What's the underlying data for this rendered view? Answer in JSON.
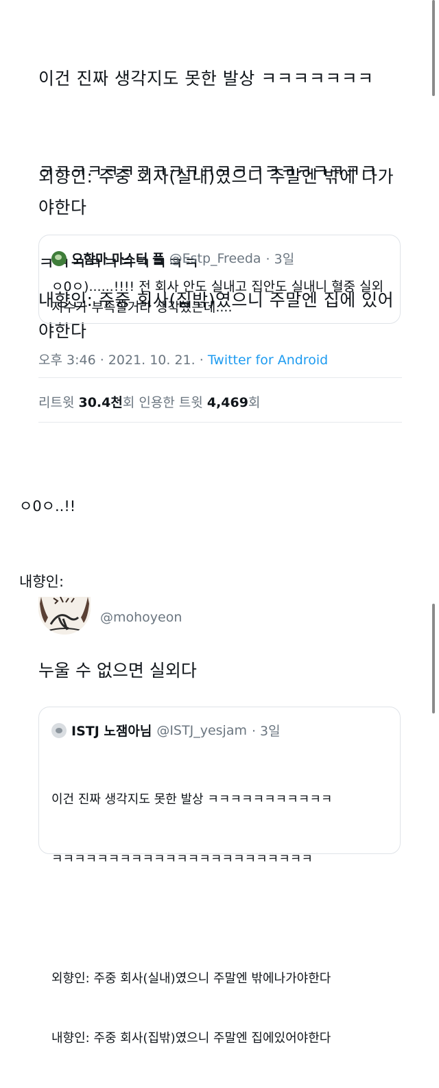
{
  "tweet1": {
    "text_line_1": "이건 진짜 생각지도 못한 발상 ㅋㅋㅋㅋㅋㅋㅋ",
    "text_line_2": "ㅋㅋㅋㅋㅋㅋㅋㅋㅋㅋㅋㅋㅋㅋㅋㅋㅋㅋㅋㅋㅋ",
    "text_line_3": "ㅋㅋㅋㅋㅋㅋㅋㅋㅋㅋ",
    "extrovert_text": "외향인: 주중 회사(실내)였으니 주말엔 밖에 나가야한다",
    "introvert_text": "내향인: 주중 회사(집밖)였으니 주말엔 집에 있어야한다",
    "quote": {
      "name": "오함마 마스터 플",
      "handle": "@Estp_Freeda",
      "age": "· 3일",
      "text": "ㅇ0ㅇ)......!!!! 전 회사 안도 실내고 집안도 실내니 혈중 실외지수가 부족할거라 생각했는데...."
    },
    "time": "오후 3:46 · 2021. 10. 21. · ",
    "source": "Twitter for Android",
    "retweet_label": "리트윗 ",
    "retweet_count": "30.4천",
    "retweet_suffix": "회  인용한 트윗 ",
    "quote_count": "4,469",
    "quote_suffix": "회"
  },
  "caption_1": "ㅇ0ㅇ..!!",
  "caption_2": "내향인:",
  "tweet2": {
    "handle": "@mohoyeon",
    "text": "누울 수 없으면 실외다",
    "quote": {
      "name": "ISTJ 노잼아님",
      "handle": "@ISTJ_yesjam",
      "age": "· 3일",
      "text_line_1": "이건 진짜 생각지도 못한 발상 ㅋㅋㅋㅋㅋㅋㅋㅋㅋㅋㅋ",
      "text_line_2": "ㅋㅋㅋㅋㅋㅋㅋㅋㅋㅋㅋㅋㅋㅋㅋㅋㅋㅋㅋㅋㅋㅋㅋ",
      "text_line_3": "외향인: 주중 회사(실내)였으니 주말엔 밖에나가야한다",
      "text_line_4": "내향인: 주중 회사(집밖)였으니 주말엔 집에있어야한다"
    }
  },
  "colors": {
    "text": "#0f1419",
    "muted": "#6b7680",
    "link": "#1d9bf0",
    "border": "#dfe3e8"
  }
}
